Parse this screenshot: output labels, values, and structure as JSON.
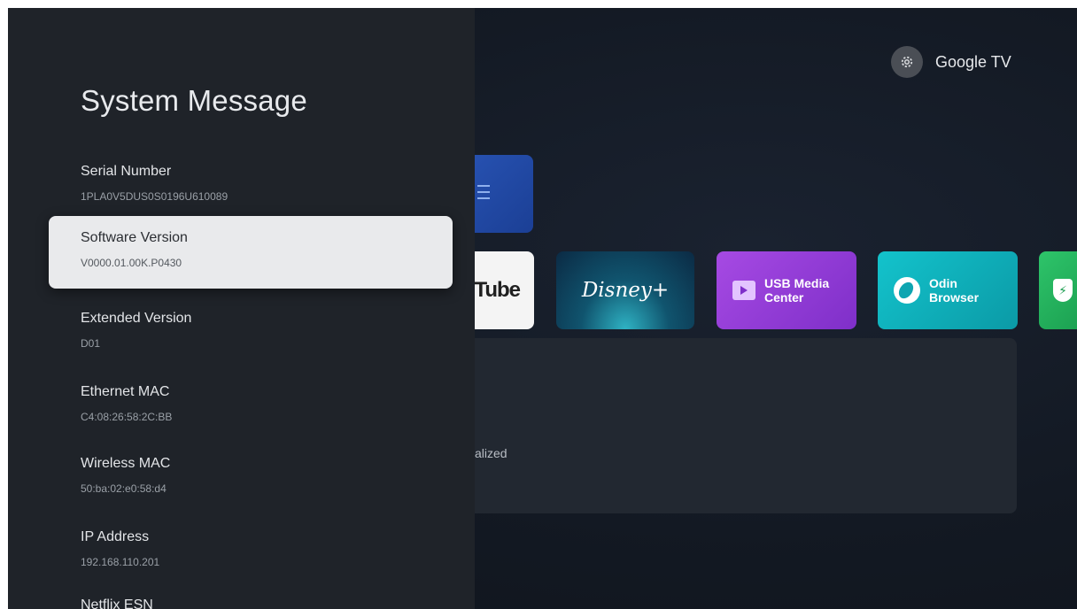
{
  "home": {
    "brand_label": "Google TV",
    "apps": [
      {
        "label": "Tube"
      },
      {
        "label": "Disney+"
      },
      {
        "label": "USB Media\nCenter"
      },
      {
        "label": "Odin\nBrowser"
      },
      {
        "label": ""
      }
    ],
    "card_text": "alized"
  },
  "system_message": {
    "title": "System Message",
    "items": [
      {
        "label": "Serial Number",
        "value": "1PLA0V5DUS0S0196U610089"
      },
      {
        "label": "Software Version",
        "value": "V0000.01.00K.P0430"
      },
      {
        "label": "Extended Version",
        "value": "D01"
      },
      {
        "label": "Ethernet MAC",
        "value": "C4:08:26:58:2C:BB"
      },
      {
        "label": "Wireless MAC",
        "value": "50:ba:02:e0:58:d4"
      },
      {
        "label": "IP Address",
        "value": "192.168.110.201"
      },
      {
        "label": "Netflix ESN",
        "value": ""
      }
    ]
  },
  "colors": {
    "panel_bg": "#1f2329",
    "focus_bg": "#e9eaec",
    "usb_tile": "#8f38d6",
    "odin_tile": "#10b3be",
    "vpn_tile": "#22b15c"
  },
  "icons": [
    "gear-icon",
    "folder-play-icon",
    "odin-leaf-icon",
    "shield-bolt-icon"
  ]
}
